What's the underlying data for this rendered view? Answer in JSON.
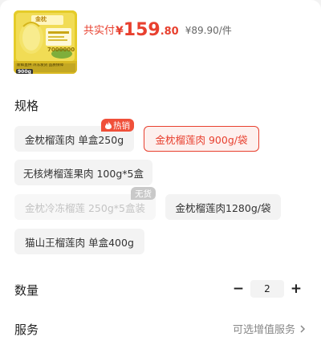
{
  "product": {
    "thumb_brand": "金枕",
    "thumb_caption": "900g",
    "thumb_sales": "7000000",
    "thumb_tags": "新鲜直供 冷冻发货 品质保障",
    "price_label": "共实付",
    "currency": "¥",
    "price_int": "159",
    "price_dec": ".80",
    "unit_price": "¥89.90/件"
  },
  "spec": {
    "title": "规格",
    "options": [
      {
        "label": "金枕榴莲肉 单盒250g",
        "badge": "热销",
        "state": "normal"
      },
      {
        "label": "金枕榴莲肉 900g/袋",
        "state": "selected"
      },
      {
        "label": "无核烤榴莲果肉 100g*5盒",
        "state": "normal"
      },
      {
        "label": "金枕冷冻榴莲 250g*5盒装",
        "badge": "无货",
        "state": "disabled"
      },
      {
        "label": "金枕榴莲肉1280g/袋",
        "state": "normal"
      },
      {
        "label": "猫山王榴莲肉 单盒400g",
        "state": "normal"
      }
    ]
  },
  "quantity": {
    "title": "数量",
    "minus": "−",
    "value": "2",
    "plus": "+"
  },
  "service": {
    "title": "服务",
    "hint": "可选增值服务"
  },
  "colors": {
    "accent": "#e8402f",
    "hot_badge": "#f0503a",
    "out_badge": "#c9c9c9"
  }
}
